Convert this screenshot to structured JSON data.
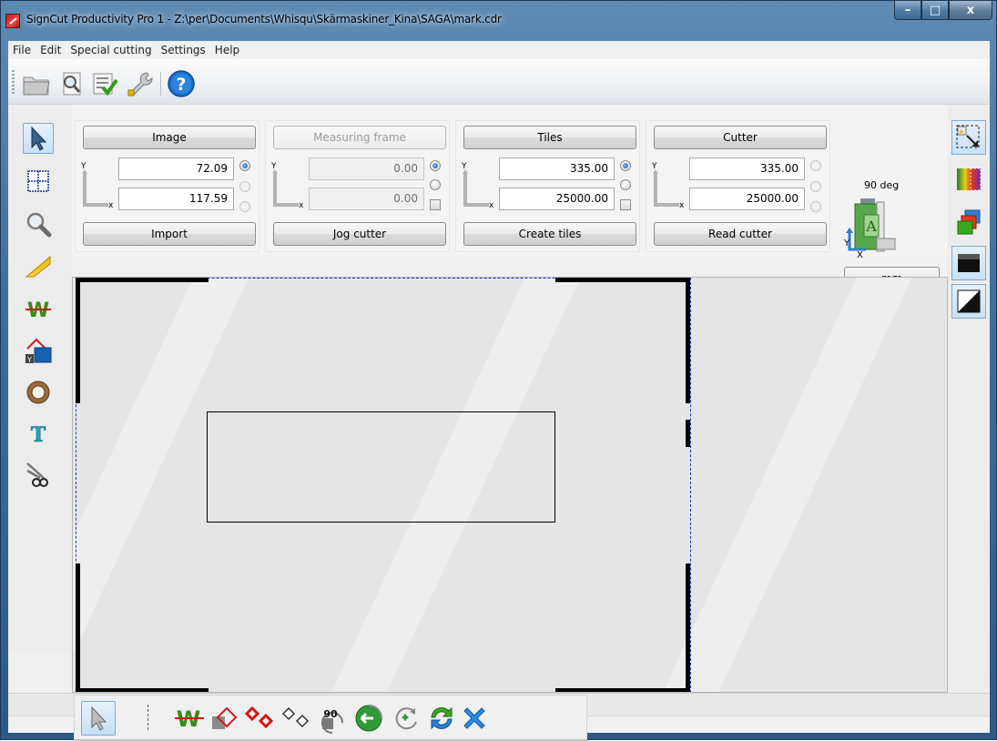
{
  "window": {
    "title": "SignCut Productivity Pro 1 - Z:\\per\\Documents\\Whisqu\\Skärmaskiner_Kina\\SAGA\\mark.cdr",
    "controls": {
      "minimize": "–",
      "maximize": "□",
      "close": "x"
    }
  },
  "menu": [
    "File",
    "Edit",
    "Special cutting",
    "Settings",
    "Help"
  ],
  "toolbar": {
    "icons": [
      "open-folder-icon",
      "preview-icon",
      "checklist-icon",
      "wrench-icon",
      "help-icon"
    ],
    "help_glyph": "?"
  },
  "panels": {
    "image": {
      "title": "Image",
      "y_value": "72.09",
      "x_value": "117.59",
      "action": "Import"
    },
    "measuring_frame": {
      "title": "Measuring frame",
      "y_value": "0.00",
      "x_value": "0.00",
      "action": "Jog cutter"
    },
    "tiles": {
      "title": "Tiles",
      "y_value": "335.00",
      "x_value": "25000.00",
      "action": "Create tiles"
    },
    "cutter": {
      "title": "Cutter",
      "y_value": "335.00",
      "x_value": "25000.00",
      "action": "Read cutter"
    },
    "rotation": {
      "label": "90 deg",
      "y_axis": "Y",
      "x_axis": "X",
      "letter": "A",
      "unit_button": "mm"
    },
    "axis_y": "Y",
    "axis_x": "x"
  },
  "left_tools": [
    "pointer-icon",
    "grid-icon",
    "zoom-icon",
    "ruler-icon",
    "weed-icon",
    "y-layer-icon",
    "ring-icon",
    "text-icon",
    "scissors-icon"
  ],
  "left_text_tool_glyph": "T",
  "right_tools": [
    "select-region-icon",
    "color-gradient-icon",
    "layers-icon",
    "black-fill-icon",
    "diagonal-fill-icon"
  ],
  "bottom_tools": [
    "pointer-icon",
    "weed-icon",
    "diamond-shadow-icon",
    "diamonds-red-icon",
    "diamonds-outline-icon",
    "rotate-90-icon",
    "rotate-left-icon",
    "rotate-cycle-icon",
    "refresh-icon",
    "delete-icon"
  ],
  "bottom_rotate_label": "90",
  "colors": {
    "title_bar": "#3e6f9b",
    "accent_blue": "#1660b8",
    "weed_green": "#3a8a1c",
    "marker_red": "#d01818",
    "frame_dash": "#1d3cb0"
  }
}
